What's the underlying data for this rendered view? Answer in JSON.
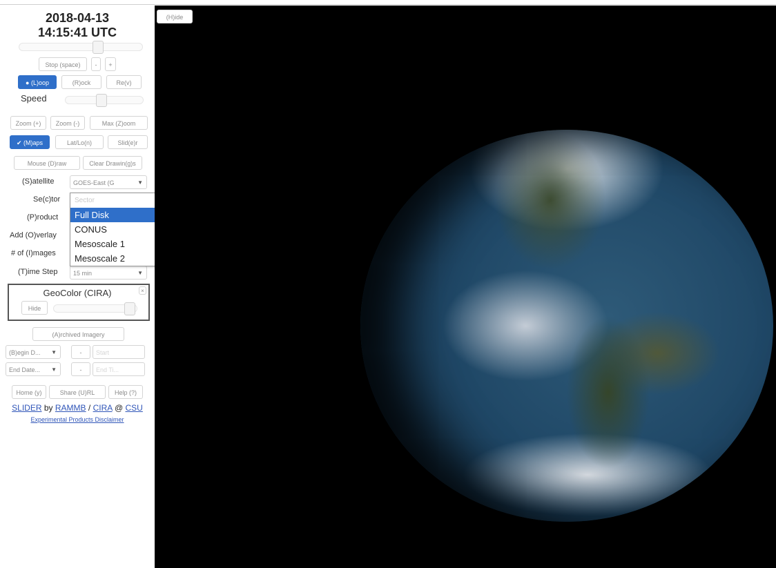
{
  "timestamp": {
    "date": "2018-04-13",
    "time": "14:15:41 UTC"
  },
  "controls": {
    "stop": "Stop (space)",
    "step_back": "-",
    "step_forward": "+",
    "loop": "(L)oop",
    "rock": "(R)ock",
    "rev": "Re(v)",
    "speed_label": "Speed",
    "zoom_in": "Zoom (+)",
    "zoom_out": "Zoom (-)",
    "max_zoom": "Max (Z)oom",
    "map": "(M)aps",
    "latlon": "Lat/Lo(n)",
    "slider_toggle": "Slid(e)r",
    "mouse_draw": "Mouse (D)raw",
    "clear_drawing": "Clear Drawin(g)s"
  },
  "fields": {
    "satellite_label": "(S)atellite",
    "satellite_value": "GOES-East (G",
    "sector_label": "Se(c)tor",
    "product_label": "(P)roduct",
    "overlay_label": "Add (O)verlay",
    "images_label": "# of (I)mages",
    "timestep_label": "(T)ime Step",
    "timestep_value": "15 min"
  },
  "sector_dropdown": {
    "placeholder": "Sector",
    "options": [
      "Full Disk",
      "CONUS",
      "Mesoscale 1",
      "Mesoscale 2"
    ],
    "selected": "Full Disk"
  },
  "layer": {
    "name": "GeoColor (CIRA)",
    "hide": "Hide"
  },
  "archive": {
    "button": "(A)rchived Imagery",
    "begin": "(B)egin D...",
    "end": "End Date...",
    "begin_time": "Start",
    "end_time": "End Ti..."
  },
  "footer": {
    "home": "Home (y)",
    "share": "Share (U)RL",
    "help": "Help (?)",
    "slider_link": "SLIDER",
    "by": "by",
    "rammb_link": "RAMMB",
    "slash": "/",
    "cira_link": "CIRA",
    "at": "@",
    "csu_link": "CSU",
    "disclaimer": "Experimental Products Disclaimer"
  },
  "viewer": {
    "hide_button": "(H)ide"
  },
  "colors": {
    "accent": "#2f6fc9",
    "background": "#000000",
    "link": "#2f55b8"
  }
}
